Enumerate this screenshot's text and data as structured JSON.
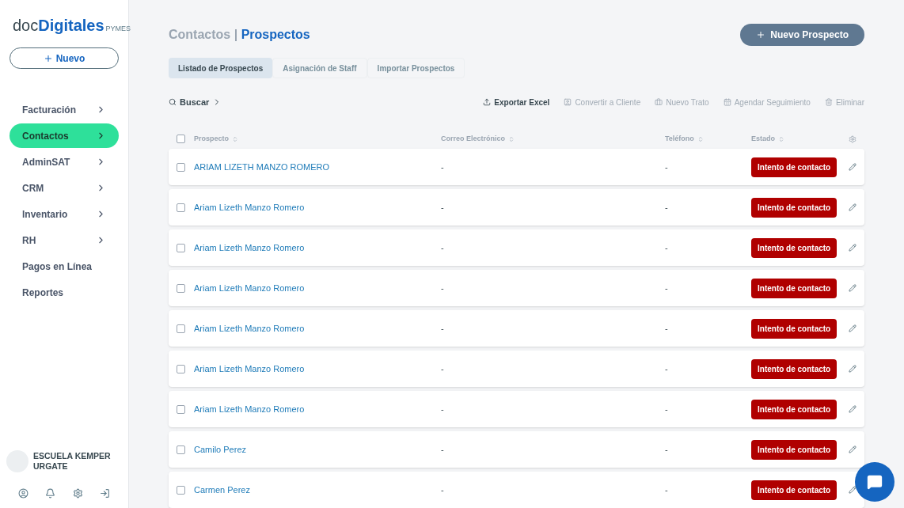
{
  "logo": {
    "main_a": "doc",
    "main_b": "Digitales",
    "suffix": "PYMES"
  },
  "new_button": {
    "label": "Nuevo"
  },
  "sidebar": {
    "items": [
      {
        "label": "Facturación",
        "selected": false,
        "submenu": true
      },
      {
        "label": "Contactos",
        "selected": true,
        "submenu": true
      },
      {
        "label": "AdminSAT",
        "selected": false,
        "submenu": true
      },
      {
        "label": "CRM",
        "selected": false,
        "submenu": true
      },
      {
        "label": "Inventario",
        "selected": false,
        "submenu": true
      },
      {
        "label": "RH",
        "selected": false,
        "submenu": true
      },
      {
        "label": "Pagos en Línea",
        "selected": false,
        "submenu": false
      },
      {
        "label": "Reportes",
        "selected": false,
        "submenu": false
      }
    ]
  },
  "account": {
    "name": "ESCUELA KEMPER URGATE"
  },
  "breadcrumb": {
    "parent": "Contactos",
    "separator": "|",
    "current": "Prospectos"
  },
  "primary_button": {
    "label": "Nuevo Prospecto"
  },
  "tabs": [
    {
      "label": "Listado de Prospectos",
      "selected": true
    },
    {
      "label": "Asignación de Staff",
      "selected": false
    },
    {
      "label": "Importar Prospectos",
      "selected": false
    }
  ],
  "search": {
    "label": "Buscar"
  },
  "actions": [
    {
      "kind": "export",
      "label": "Exportar Excel",
      "disabled": false
    },
    {
      "kind": "convert",
      "label": "Convertir a Cliente",
      "disabled": true
    },
    {
      "kind": "deal",
      "label": "Nuevo Trato",
      "disabled": true
    },
    {
      "kind": "schedule",
      "label": "Agendar Seguimiento",
      "disabled": true
    },
    {
      "kind": "delete",
      "label": "Eliminar",
      "disabled": true
    }
  ],
  "table": {
    "select_all": false,
    "columns": [
      "Prospecto",
      "Correo Electrónico",
      "Teléfono",
      "Estado"
    ],
    "rows": [
      {
        "name": "ARIAM LIZETH MANZO ROMERO",
        "email": "-",
        "phone": "-",
        "status": "Intento de contacto",
        "checked": false
      },
      {
        "name": "Ariam Lizeth Manzo Romero",
        "email": "-",
        "phone": "-",
        "status": "Intento de contacto",
        "checked": false
      },
      {
        "name": "Ariam Lizeth Manzo Romero",
        "email": "-",
        "phone": "-",
        "status": "Intento de contacto",
        "checked": false
      },
      {
        "name": "Ariam Lizeth Manzo Romero",
        "email": "-",
        "phone": "-",
        "status": "Intento de contacto",
        "checked": false
      },
      {
        "name": "Ariam Lizeth Manzo Romero",
        "email": "-",
        "phone": "-",
        "status": "Intento de contacto",
        "checked": false
      },
      {
        "name": "Ariam Lizeth Manzo Romero",
        "email": "-",
        "phone": "-",
        "status": "Intento de contacto",
        "checked": false
      },
      {
        "name": "Ariam Lizeth Manzo Romero",
        "email": "-",
        "phone": "-",
        "status": "Intento de contacto",
        "checked": false
      },
      {
        "name": "Camilo Perez",
        "email": "-",
        "phone": "-",
        "status": "Intento de contacto",
        "checked": false
      },
      {
        "name": "Carmen Perez",
        "email": "-",
        "phone": "-",
        "status": "Intento de contacto",
        "checked": false
      }
    ]
  }
}
